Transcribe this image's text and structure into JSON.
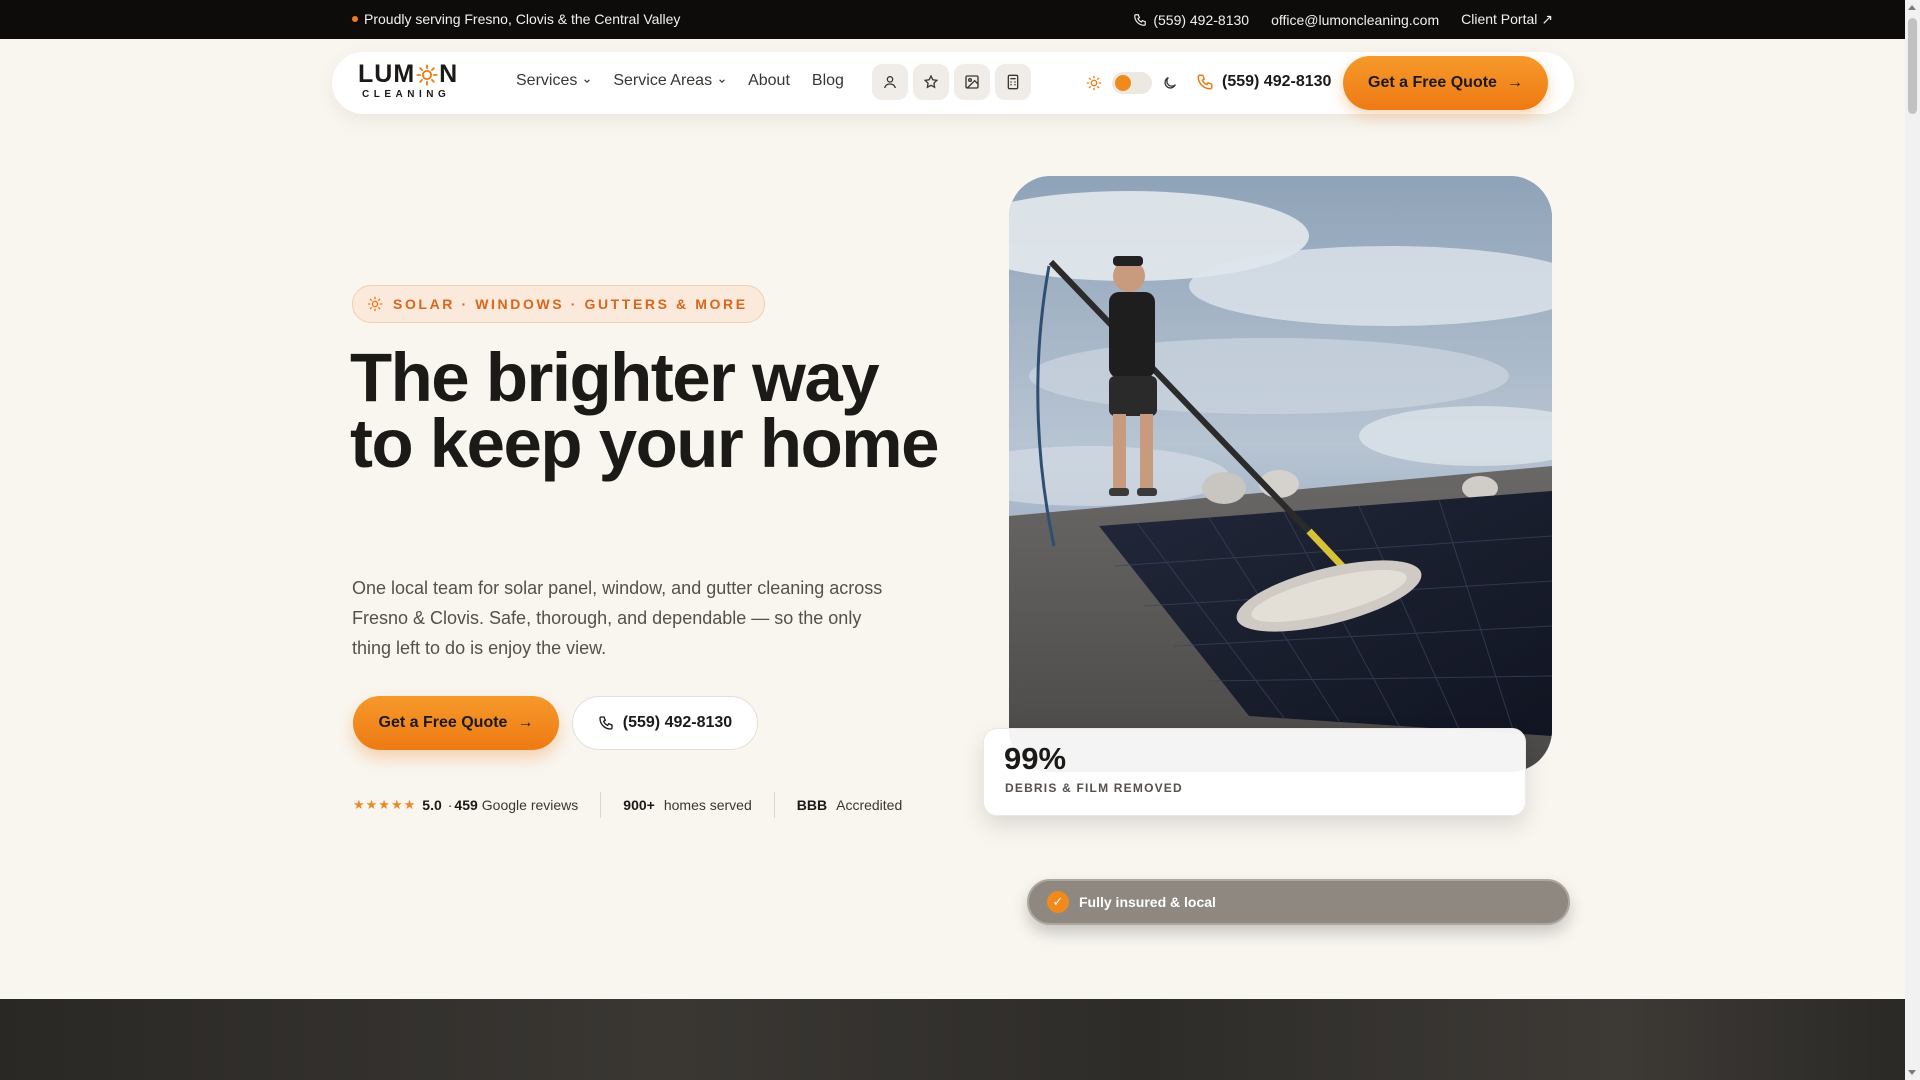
{
  "topbar": {
    "serving": "Proudly serving Fresno, Clovis & the Central Valley",
    "phone": "(559) 492-8130",
    "email": "office@lumoncleaning.com",
    "portal": "Client Portal ↗"
  },
  "nav": {
    "logo_main_left": "LUM",
    "logo_main_right": "N",
    "logo_sub": "CLEANING",
    "links": [
      "Services",
      "Service Areas",
      "About",
      "Blog"
    ],
    "phone": "(559) 492-8130",
    "cta": "Get a Free Quote",
    "cta_arrow": "→"
  },
  "hero": {
    "badge": "SOLAR · WINDOWS · GUTTERS & MORE",
    "headline_line1": "The brighter way",
    "headline_line2": "to keep your home",
    "lead": "One local team for solar panel, window, and gutter cleaning across Fresno & Clovis. Safe, thorough, and dependable — so the only thing left to do is enjoy the view.",
    "primary_cta": "Get a Free Quote",
    "primary_arrow": "→",
    "secondary_cta": "(559) 492-8130",
    "stats": {
      "stars": "★★★★★",
      "rating": "5.0",
      "reviews_prefix": "·",
      "reviews_count": "459",
      "reviews_label": "Google reviews",
      "homes_count": "900+",
      "homes_label": "homes served",
      "bbb": "BBB",
      "bbb_label": "Accredited"
    }
  },
  "statcard": {
    "value": "99%",
    "label": "DEBRIS & FILM REMOVED"
  },
  "pill": {
    "check": "✓",
    "label": "Fully insured & local"
  },
  "colors": {
    "accent": "#ee7a14",
    "background": "#f9f6f0",
    "text": "#1c1a17"
  }
}
